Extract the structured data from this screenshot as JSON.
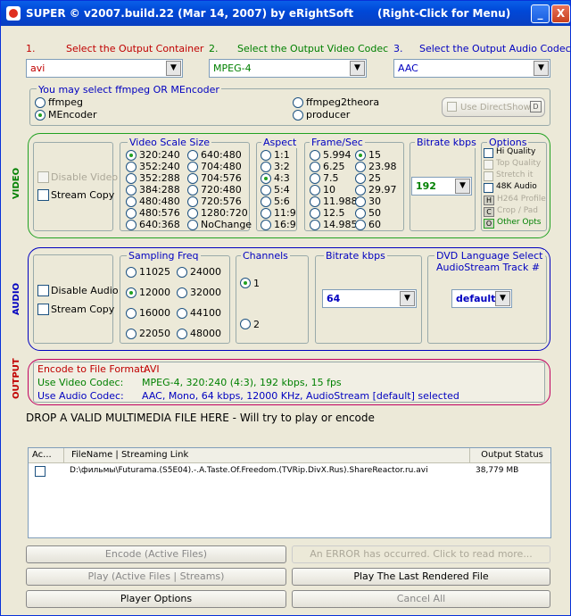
{
  "title": {
    "text": "SUPER © v2007.build.22 (Mar 14, 2007) by eRightSoft",
    "hint": "(Right-Click for Menu)",
    "min": "_",
    "close": "X"
  },
  "steps": {
    "s1": {
      "num": "1.",
      "label": "Select the Output Container"
    },
    "s2": {
      "num": "2.",
      "label": "Select the Output Video Codec"
    },
    "s3": {
      "num": "3.",
      "label": "Select the Output Audio Codec"
    }
  },
  "combos": {
    "container": "avi",
    "vcodec": "MPEG-4",
    "acodec": "AAC",
    "vbitrate": "192",
    "abitrate": "64",
    "dvdlang": "default"
  },
  "encoder": {
    "heading": "You may select ffmpeg OR MEncoder",
    "ffmpeg": "ffmpeg",
    "mencoder": "MEncoder",
    "ffmpeg2theora": "ffmpeg2theora",
    "producer": "producer",
    "directshow": "Use DirectShow",
    "d": "D"
  },
  "video": {
    "side": "VIDEO",
    "disable": "Disable Video",
    "streamcopy": "Stream Copy",
    "scale_title": "Video Scale Size",
    "scale_col1": [
      "320:240",
      "352:240",
      "352:288",
      "384:288",
      "480:480",
      "480:576",
      "640:368"
    ],
    "scale_col2": [
      "640:480",
      "704:480",
      "704:576",
      "720:480",
      "720:576",
      "1280:720",
      "NoChange"
    ],
    "aspect_title": "Aspect",
    "aspect": [
      "1:1",
      "3:2",
      "4:3",
      "5:4",
      "5:6",
      "11:9",
      "16:9"
    ],
    "fps_title": "Frame/Sec",
    "fps_col1": [
      "5.994",
      "6.25",
      "7.5",
      "10",
      "11.988",
      "12.5",
      "14.985"
    ],
    "fps_col2": [
      "15",
      "23.98",
      "25",
      "29.97",
      "30",
      "50",
      "60"
    ],
    "bitrate_title": "Bitrate  kbps",
    "options_title": "Options",
    "opt": {
      "hq": "Hi Quality",
      "tq": "Top Quality",
      "stretch": "Stretch it",
      "k48": "48K Audio",
      "h264": "H264 Profile",
      "crop": "Crop / Pad",
      "other": "Other Opts",
      "h": "H",
      "c": "C",
      "o": "O"
    }
  },
  "audio": {
    "side": "AUDIO",
    "disable": "Disable Audio",
    "streamcopy": "Stream Copy",
    "freq_title": "Sampling Freq",
    "freq_col1": [
      "11025",
      "12000",
      "16000",
      "22050"
    ],
    "freq_col2": [
      "24000",
      "32000",
      "44100",
      "48000"
    ],
    "channels_title": "Channels",
    "channels": [
      "1",
      "2"
    ],
    "bitrate_title": "Bitrate  kbps",
    "dvd_title": "DVD Language Select",
    "dvd_sub": "AudioStream  Track #"
  },
  "output": {
    "side": "OUTPUT",
    "fmt_label": "Encode to File Format:",
    "fmt_value": "AVI",
    "vc_label": "Use Video Codec:",
    "vc_value": "MPEG-4,  320:240 (4:3),  192 kbps,  15 fps",
    "ac_label": "Use Audio Codec:",
    "ac_value": "AAC,  Mono,  64 kbps,  12000 KHz,  AudioStream [default] selected"
  },
  "drop": "DROP A VALID MULTIMEDIA FILE HERE - Will try to play or encode",
  "files": {
    "cols": {
      "active": "Ac...",
      "name": "FileName  |  Streaming Link",
      "status": "Output Status"
    },
    "rows": [
      {
        "name": "D:\\фильмы\\Futurama.(S5E04).-.A.Taste.Of.Freedom.(TVRip.DivX.Rus).ShareReactor.ru.avi",
        "status": "38,779 MB"
      }
    ]
  },
  "buttons": {
    "encode": "Encode (Active Files)",
    "error": "An ERROR has occurred. Click to read more...",
    "play": "Play (Active Files | Streams)",
    "playlast": "Play The Last Rendered File",
    "playeropts": "Player Options",
    "cancel": "Cancel All"
  }
}
